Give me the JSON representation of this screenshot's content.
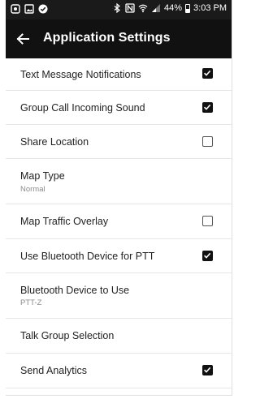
{
  "status_bar": {
    "battery": "44%",
    "battery_level": 0.44,
    "time": "3:03 PM"
  },
  "app_bar": {
    "title": "Application Settings"
  },
  "settings": [
    {
      "label": "Text Message Notifications",
      "checked": true
    },
    {
      "label": "Group Call Incoming Sound",
      "checked": true
    },
    {
      "label": "Share Location",
      "checked": false
    },
    {
      "label": "Map Type",
      "subtitle": "Normal"
    },
    {
      "label": "Map Traffic Overlay",
      "checked": false
    },
    {
      "label": "Use Bluetooth Device for PTT",
      "checked": true
    },
    {
      "label": "Bluetooth Device to Use",
      "subtitle": "PTT-Z"
    },
    {
      "label": "Talk Group Selection"
    },
    {
      "label": "Send Analytics",
      "checked": true
    }
  ],
  "colors": {
    "app_bar": "#111111",
    "status_bar": "#1a1a1a",
    "checkbox_checked": "#111111"
  }
}
